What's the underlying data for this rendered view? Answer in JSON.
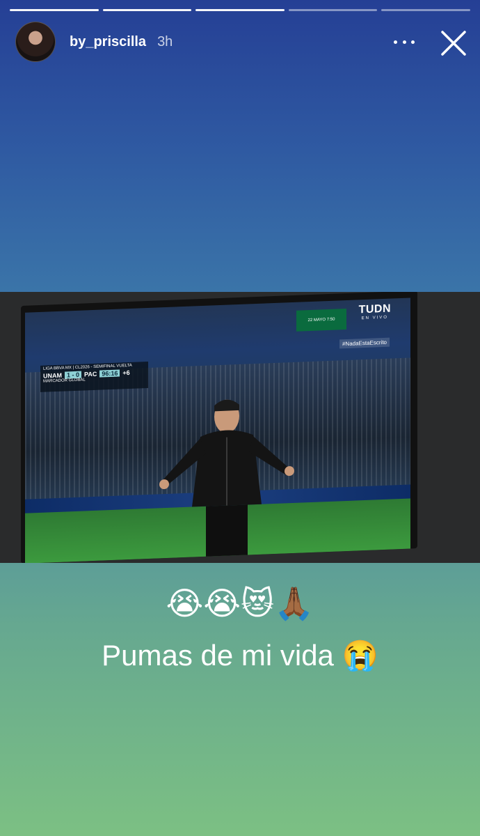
{
  "story": {
    "progress_segments": 5,
    "segments_viewed": 3
  },
  "header": {
    "username": "by_priscilla",
    "time_ago": "3h",
    "more_icon": "ellipsis-icon",
    "close_icon": "close-icon"
  },
  "tv_broadcast": {
    "scorebug_league": "LIGA BBVA MX | CL2026 - SEMIFINAL VUELTA",
    "home_team": "UNAM",
    "score": "1 - 0",
    "away_team": "PAC",
    "clock": "96:16",
    "added_time": "+6",
    "aggregate_label": "MARCADOR GLOBAL",
    "network": "TUDN",
    "network_sub": "EN VIVO",
    "promo_date": "22 MAYO",
    "promo_time": "7:50",
    "hashtag": "#NadaEstaEscrito"
  },
  "caption": {
    "emoji_line": "😭😭😻🙏🏾",
    "text": "Pumas de mi vida 😭"
  }
}
